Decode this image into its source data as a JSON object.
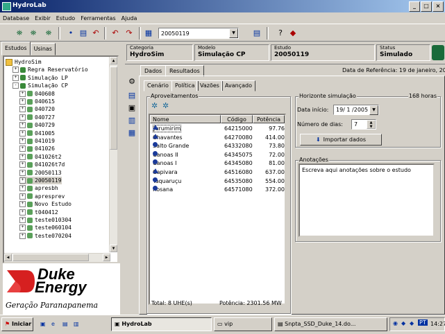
{
  "window": {
    "title": "HydroLab",
    "buttons": [
      "_",
      "□",
      "×"
    ]
  },
  "menu": [
    "Database",
    "Exibir",
    "Estudo",
    "Ferramentas",
    "Ajuda"
  ],
  "toolbar": {
    "combo_value": "20050119"
  },
  "left_tabs": [
    "Estudos",
    "Usinas"
  ],
  "tree": [
    {
      "label": "HydroSim",
      "level": 0,
      "icon": "folder-icon"
    },
    {
      "label": "Regra Reservatório",
      "level": 1,
      "icon": "study-icon",
      "pm": "+"
    },
    {
      "label": "Simulação LP",
      "level": 1,
      "icon": "study-icon",
      "pm": "+"
    },
    {
      "label": "Simulação CP",
      "level": 1,
      "icon": "study-icon",
      "pm": "-"
    },
    {
      "label": "040608",
      "level": 2,
      "pm": "+"
    },
    {
      "label": "040615",
      "level": 2,
      "pm": "+"
    },
    {
      "label": "040720",
      "level": 2,
      "pm": "+"
    },
    {
      "label": "040727",
      "level": 2,
      "pm": "+"
    },
    {
      "label": "040729",
      "level": 2,
      "pm": "+"
    },
    {
      "label": "041005",
      "level": 2,
      "pm": "+"
    },
    {
      "label": "041019",
      "level": 2,
      "pm": "+"
    },
    {
      "label": "041026",
      "level": 2,
      "pm": "+"
    },
    {
      "label": "041026t2",
      "level": 2,
      "pm": "+"
    },
    {
      "label": "041026t7d",
      "level": 2,
      "pm": "+"
    },
    {
      "label": "20050113",
      "level": 2,
      "pm": "+"
    },
    {
      "label": "20050119",
      "level": 2,
      "pm": "+",
      "selected": true
    },
    {
      "label": "apresbh",
      "level": 2,
      "pm": "+"
    },
    {
      "label": "apresprev",
      "level": 2,
      "pm": "+"
    },
    {
      "label": "Novo Estudo",
      "level": 2,
      "pm": "+"
    },
    {
      "label": "t040412",
      "level": 2,
      "pm": "+"
    },
    {
      "label": "teste010304",
      "level": 2,
      "pm": "+"
    },
    {
      "label": "teste060104",
      "level": 2,
      "pm": "+"
    },
    {
      "label": "teste070204",
      "level": 2,
      "pm": "+"
    }
  ],
  "logo": {
    "line1": "Duke",
    "line2": "Energy",
    "tagline": "Geração Paranapanema"
  },
  "info": {
    "categoria_label": "Categoria",
    "categoria": "HydroSim",
    "modelo_label": "Modelo",
    "modelo": "Simulação CP",
    "estudo_label": "Estudo",
    "estudo": "20050119",
    "status_label": "Status",
    "status": "Simulado"
  },
  "top_tabs": [
    "Dados",
    "Resultados"
  ],
  "ref_date": "Data de Referência: 19 de janeiro, 20",
  "sub_tabs": [
    "Cenário",
    "Política",
    "Vazões",
    "Avançado"
  ],
  "aproveitamentos": {
    "title": "Aproveitamentos",
    "columns": [
      "Nome",
      "Código",
      "Potência"
    ],
    "rows": [
      {
        "nome": "Jurumirim",
        "codigo": "64215000",
        "potencia": "97.76",
        "icon": "reservoir-triangle-icon"
      },
      {
        "nome": "Chavantes",
        "codigo": "64270080",
        "potencia": "414.00",
        "icon": "reservoir-triangle-icon"
      },
      {
        "nome": "Salto Grande",
        "codigo": "64332080",
        "potencia": "73.80",
        "icon": "run-of-river-dot-icon"
      },
      {
        "nome": "Canoas II",
        "codigo": "64345075",
        "potencia": "72.00",
        "icon": "run-of-river-dot-icon"
      },
      {
        "nome": "Canoas I",
        "codigo": "64345080",
        "potencia": "81.00",
        "icon": "run-of-river-dot-icon"
      },
      {
        "nome": "Capivara",
        "codigo": "64516080",
        "potencia": "637.00",
        "icon": "reservoir-triangle-icon"
      },
      {
        "nome": "Taquaruçu",
        "codigo": "64535080",
        "potencia": "554.00",
        "icon": "run-of-river-dot-icon"
      },
      {
        "nome": "Rosana",
        "codigo": "64571080",
        "potencia": "372.00",
        "icon": "run-of-river-dot-icon"
      }
    ],
    "total": "Total: 8 UHE(s)",
    "potencia_total": "Potência: 2301.56 MW"
  },
  "horizonte": {
    "title": "Horizonte simulação",
    "hours": "168 horas",
    "inicio_label": "Data início:",
    "inicio_value": "19/ 1 /2005",
    "dias_label": "Número de dias:",
    "dias_value": "7",
    "import_button": "Importar dados"
  },
  "anotacoes": {
    "title": "Anotações",
    "text": "Escreva aqui anotações sobre o estudo"
  },
  "taskbar": {
    "start": "Iniciar",
    "items": [
      "HydroLab",
      "vip",
      "Snpta_SSD_Duke_14.do..."
    ],
    "lang": "PT",
    "clock": "14:27"
  }
}
